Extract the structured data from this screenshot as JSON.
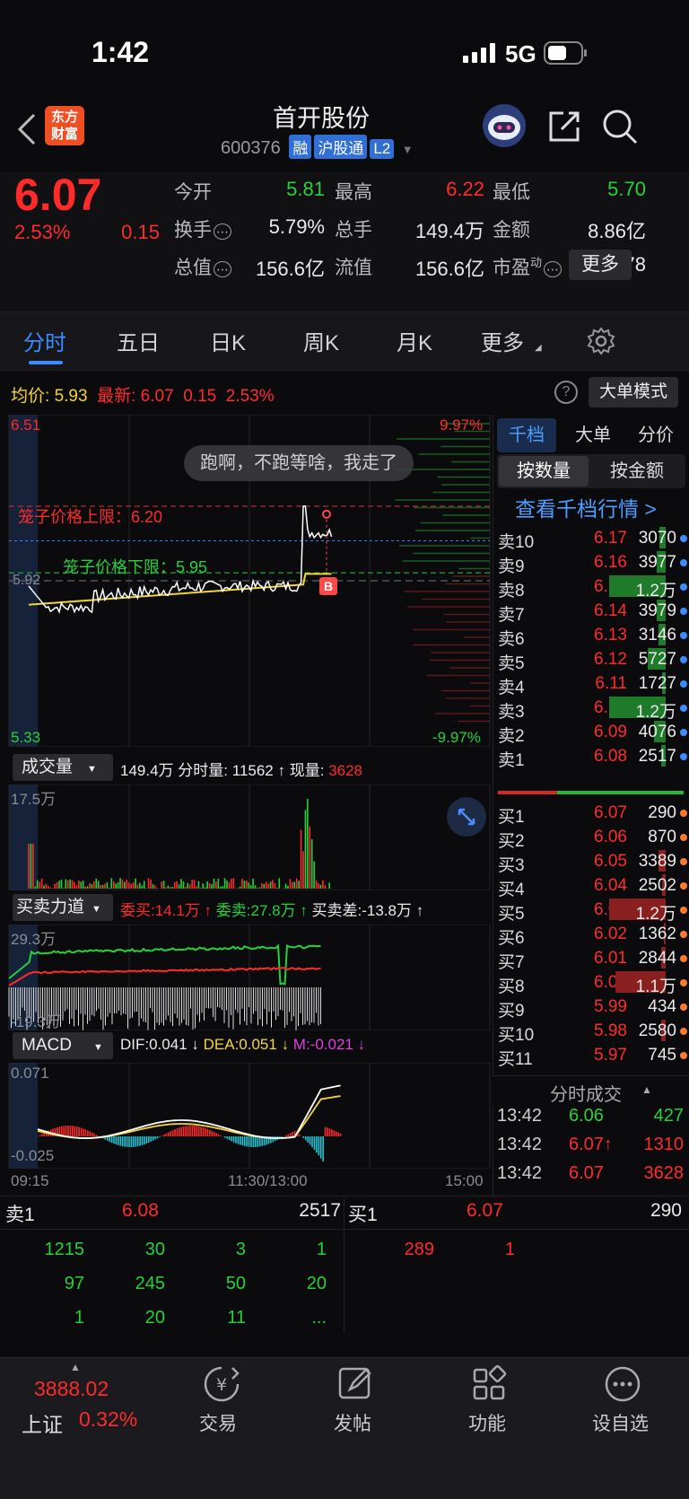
{
  "status_bar": {
    "time": "1:42",
    "network": "5G"
  },
  "header": {
    "logo_line1": "东方",
    "logo_line2": "财富",
    "title": "首开股份",
    "code": "600376",
    "tags": [
      "融",
      "沪股通",
      "L2"
    ]
  },
  "quote": {
    "price": "6.07",
    "pct": "2.53%",
    "chg": "0.15",
    "stats": [
      {
        "label": "今开",
        "value": "5.81",
        "color": "#27d13a"
      },
      {
        "label": "最高",
        "value": "6.22",
        "color": "#ff2b2b"
      },
      {
        "label": "最低",
        "value": "5.70",
        "color": "#27d13a"
      },
      {
        "label": "换手",
        "value": "5.79%",
        "color": "#eaeaea"
      },
      {
        "label": "总手",
        "value": "149.4万",
        "color": "#eaeaea"
      },
      {
        "label": "金额",
        "value": "8.86亿",
        "color": "#eaeaea"
      },
      {
        "label": "总值",
        "value": "156.6亿",
        "color": "#eaeaea"
      },
      {
        "label": "流值",
        "value": "156.6亿",
        "color": "#eaeaea"
      },
      {
        "label": "市盈",
        "label_sup": "动",
        "value": "-3.78",
        "color": "#eaeaea"
      }
    ],
    "more_label": "更多"
  },
  "tabs": [
    "分时",
    "五日",
    "日K",
    "周K",
    "月K",
    "更多"
  ],
  "summary": {
    "avg_label": "均价:",
    "avg": "5.93",
    "last_label": "最新:",
    "last": "6.07",
    "chg": "0.15",
    "pct": "2.53%",
    "big_order": "大单模式"
  },
  "chart": {
    "y_top": "6.51",
    "y_bottom": "5.33",
    "pct_top": "9.97%",
    "pct_bottom": "-9.97%",
    "mid": "5.92",
    "upper_limit": "笼子价格上限：6.20",
    "lower_limit": "笼子价格下限：5.95",
    "toast": "跑啊，不跑等啥，我走了",
    "trade_badge": "B"
  },
  "volume": {
    "label": "成交量",
    "total": "149.4万",
    "minute_label": "分时量:",
    "minute": "11562",
    "current_label": "现量:",
    "current": "3628",
    "max": "17.5万"
  },
  "force": {
    "label": "买卖力道",
    "buy": "委买:14.1万",
    "sell": "委卖:27.8万",
    "diff": "买卖差:-13.8万",
    "top": "29.3万",
    "bottom": "-19.3万"
  },
  "macd": {
    "label": "MACD",
    "dif": "DIF:0.041",
    "dea": "DEA:0.051",
    "m": "M:-0.021",
    "top": "0.071",
    "bottom": "-0.025"
  },
  "time_axis": [
    "09:15",
    "11:30/13:00",
    "15:00"
  ],
  "side": {
    "tabs": [
      "千档",
      "大单",
      "分价"
    ],
    "sub_tabs": [
      "按数量",
      "按金额"
    ],
    "link": "查看千档行情 >"
  },
  "asks": [
    {
      "label": "卖10",
      "price": "6.17",
      "vol": "3070",
      "bar": 0.1
    },
    {
      "label": "卖9",
      "price": "6.16",
      "vol": "3977",
      "bar": 0.15
    },
    {
      "label": "卖8",
      "price": "6.15",
      "vol": "1.2万",
      "bar": 0.95
    },
    {
      "label": "卖7",
      "price": "6.14",
      "vol": "3979",
      "bar": 0.15
    },
    {
      "label": "卖6",
      "price": "6.13",
      "vol": "3146",
      "bar": 0.12
    },
    {
      "label": "卖5",
      "price": "6.12",
      "vol": "5727",
      "bar": 0.3
    },
    {
      "label": "卖4",
      "price": "6.11",
      "vol": "1727",
      "bar": 0.06
    },
    {
      "label": "卖3",
      "price": "6.10",
      "vol": "1.2万",
      "bar": 0.95
    },
    {
      "label": "卖2",
      "price": "6.09",
      "vol": "4076",
      "bar": 0.2
    },
    {
      "label": "卖1",
      "price": "6.08",
      "vol": "2517",
      "bar": 0.08
    }
  ],
  "bids": [
    {
      "label": "买1",
      "price": "6.07",
      "vol": "290",
      "bar": 0.0
    },
    {
      "label": "买2",
      "price": "6.06",
      "vol": "870",
      "bar": 0.0
    },
    {
      "label": "买3",
      "price": "6.05",
      "vol": "3389",
      "bar": 0.12
    },
    {
      "label": "买4",
      "price": "6.04",
      "vol": "2502",
      "bar": 0.06
    },
    {
      "label": "买5",
      "price": "6.03",
      "vol": "1.2万",
      "bar": 0.95
    },
    {
      "label": "买6",
      "price": "6.02",
      "vol": "1362",
      "bar": 0.03
    },
    {
      "label": "买7",
      "price": "6.01",
      "vol": "2844",
      "bar": 0.08
    },
    {
      "label": "买8",
      "price": "6.00",
      "vol": "1.1万",
      "bar": 0.85
    },
    {
      "label": "买9",
      "price": "5.99",
      "vol": "434",
      "bar": 0.0
    },
    {
      "label": "买10",
      "price": "5.98",
      "vol": "2580",
      "bar": 0.07
    },
    {
      "label": "买11",
      "price": "5.97",
      "vol": "745",
      "bar": 0.0
    }
  ],
  "ticks_label": "分时成交",
  "ticks": [
    {
      "time": "13:42",
      "price": "6.06",
      "vol": "427",
      "pc": "#27d13a",
      "vc": "#27d13a"
    },
    {
      "time": "13:42",
      "price": "6.07↑",
      "vol": "1310",
      "pc": "#ff2b2b",
      "vc": "#ff2b2b"
    },
    {
      "time": "13:42",
      "price": "6.07",
      "vol": "3628",
      "pc": "#ff2b2b",
      "vc": "#ff2b2b"
    }
  ],
  "queue": {
    "sell_label": "卖1",
    "sell_price": "6.08",
    "sell_total": "2517",
    "buy_label": "买1",
    "buy_price": "6.07",
    "buy_total": "290",
    "sell_rows": [
      [
        "1215",
        "30",
        "3",
        "1"
      ],
      [
        "97",
        "245",
        "50",
        "20"
      ],
      [
        "1",
        "20",
        "11",
        "..."
      ]
    ],
    "buy_rows": [
      [
        "289",
        "1"
      ]
    ]
  },
  "bottom_nav": {
    "index_value": "3888.02",
    "index_name": "上证",
    "index_pct": "0.32%",
    "items": [
      "交易",
      "发帖",
      "功能",
      "设自选"
    ]
  }
}
